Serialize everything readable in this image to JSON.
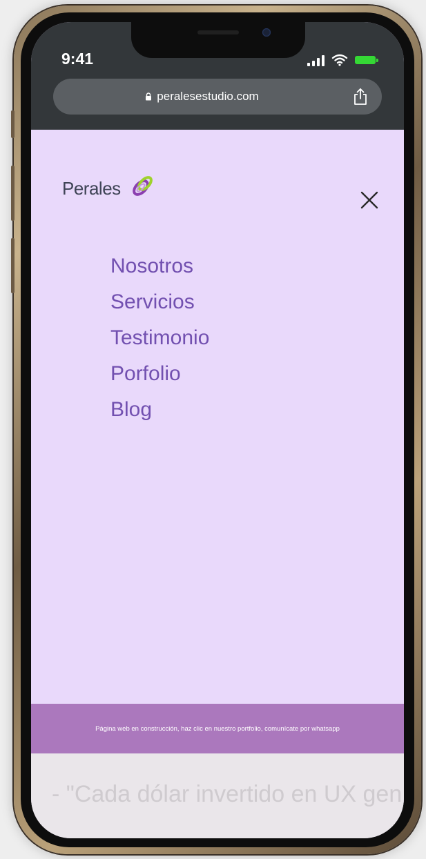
{
  "status_bar": {
    "time": "9:41"
  },
  "browser": {
    "url": "peralesestudio.com"
  },
  "logo": {
    "text": "Perales"
  },
  "nav": {
    "items": [
      {
        "label": "Nosotros"
      },
      {
        "label": "Servicios"
      },
      {
        "label": "Testimonio"
      },
      {
        "label": "Porfolio"
      },
      {
        "label": "Blog"
      }
    ]
  },
  "info_bar": {
    "text": "Página web en construcción, haz clic en nuestro portfolio, comunícate por whatsapp"
  },
  "quote": {
    "text": "- \"Cada dólar invertido en UX gen"
  },
  "colors": {
    "screen_background": "#e9d9fb",
    "browser_chrome": "#33373a",
    "nav_text": "#7250b0",
    "info_bar": "#ab78bd",
    "battery": "#35d835"
  }
}
